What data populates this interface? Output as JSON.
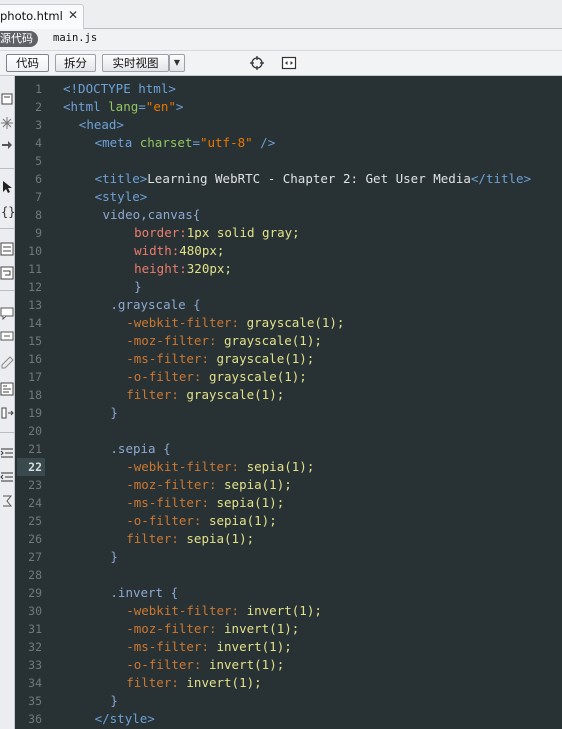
{
  "tab": {
    "filename": "photo.html",
    "close": "✕"
  },
  "filebar": {
    "source_label": "源代码",
    "related_file": "main.js"
  },
  "viewbar": {
    "code_label": "代码",
    "split_label": "拆分",
    "live_label": "实时视图",
    "dropdown_glyph": "▼"
  },
  "editor": {
    "current_line": 22,
    "lines": [
      {
        "n": "1",
        "indent": 0,
        "tokens": [
          {
            "t": "<!DOCTYPE html>",
            "c": "tag"
          }
        ]
      },
      {
        "n": "2",
        "indent": 0,
        "tokens": [
          {
            "t": "<html ",
            "c": "tag"
          },
          {
            "t": "lang",
            "c": "attr"
          },
          {
            "t": "=",
            "c": "tag"
          },
          {
            "t": "\"en\"",
            "c": "str"
          },
          {
            "t": ">",
            "c": "tag"
          }
        ]
      },
      {
        "n": "3",
        "indent": 2,
        "tokens": [
          {
            "t": "<head>",
            "c": "tag"
          }
        ]
      },
      {
        "n": "4",
        "indent": 4,
        "tokens": [
          {
            "t": "<meta ",
            "c": "tag"
          },
          {
            "t": "charset",
            "c": "attr"
          },
          {
            "t": "=",
            "c": "tag"
          },
          {
            "t": "\"utf-8\"",
            "c": "str"
          },
          {
            "t": " />",
            "c": "tag"
          }
        ]
      },
      {
        "n": "5",
        "indent": 0,
        "tokens": []
      },
      {
        "n": "6",
        "indent": 4,
        "tokens": [
          {
            "t": "<title>",
            "c": "tag"
          },
          {
            "t": "Learning WebRTC - Chapter 2: Get User Media",
            "c": "txt"
          },
          {
            "t": "</title>",
            "c": "tag"
          }
        ]
      },
      {
        "n": "7",
        "indent": 4,
        "tokens": [
          {
            "t": "<style>",
            "c": "tag"
          }
        ]
      },
      {
        "n": "8",
        "indent": 5,
        "tokens": [
          {
            "t": "video,canvas{",
            "c": "sel"
          }
        ]
      },
      {
        "n": "9",
        "indent": 9,
        "tokens": [
          {
            "t": "border:",
            "c": "prop2"
          },
          {
            "t": "1px solid gray;",
            "c": "val"
          }
        ]
      },
      {
        "n": "10",
        "indent": 9,
        "tokens": [
          {
            "t": "width:",
            "c": "prop2"
          },
          {
            "t": "480px;",
            "c": "val"
          }
        ]
      },
      {
        "n": "11",
        "indent": 9,
        "tokens": [
          {
            "t": "height:",
            "c": "prop2"
          },
          {
            "t": "320px;",
            "c": "val"
          }
        ]
      },
      {
        "n": "12",
        "indent": 9,
        "tokens": [
          {
            "t": "}",
            "c": "sel"
          }
        ]
      },
      {
        "n": "13",
        "indent": 6,
        "tokens": [
          {
            "t": ".grayscale {",
            "c": "sel"
          }
        ]
      },
      {
        "n": "14",
        "indent": 8,
        "tokens": [
          {
            "t": "-webkit-filter: ",
            "c": "prop"
          },
          {
            "t": "grayscale(1);",
            "c": "val"
          }
        ]
      },
      {
        "n": "15",
        "indent": 8,
        "tokens": [
          {
            "t": "-moz-filter: ",
            "c": "prop"
          },
          {
            "t": "grayscale(1);",
            "c": "val"
          }
        ]
      },
      {
        "n": "16",
        "indent": 8,
        "tokens": [
          {
            "t": "-ms-filter: ",
            "c": "prop"
          },
          {
            "t": "grayscale(1);",
            "c": "val"
          }
        ]
      },
      {
        "n": "17",
        "indent": 8,
        "tokens": [
          {
            "t": "-o-filter: ",
            "c": "prop"
          },
          {
            "t": "grayscale(1);",
            "c": "val"
          }
        ]
      },
      {
        "n": "18",
        "indent": 8,
        "tokens": [
          {
            "t": "filter: ",
            "c": "prop"
          },
          {
            "t": "grayscale(1);",
            "c": "val"
          }
        ]
      },
      {
        "n": "19",
        "indent": 6,
        "tokens": [
          {
            "t": "}",
            "c": "sel"
          }
        ]
      },
      {
        "n": "20",
        "indent": 0,
        "tokens": []
      },
      {
        "n": "21",
        "indent": 6,
        "tokens": [
          {
            "t": ".sepia {",
            "c": "sel"
          }
        ]
      },
      {
        "n": "22",
        "indent": 8,
        "tokens": [
          {
            "t": "-webkit-filter: ",
            "c": "prop"
          },
          {
            "t": "sepia(1);",
            "c": "val"
          }
        ]
      },
      {
        "n": "23",
        "indent": 8,
        "tokens": [
          {
            "t": "-moz-filter: ",
            "c": "prop"
          },
          {
            "t": "sepia(1);",
            "c": "val"
          }
        ]
      },
      {
        "n": "24",
        "indent": 8,
        "tokens": [
          {
            "t": "-ms-filter: ",
            "c": "prop"
          },
          {
            "t": "sepia(1);",
            "c": "val"
          }
        ]
      },
      {
        "n": "25",
        "indent": 8,
        "tokens": [
          {
            "t": "-o-filter: ",
            "c": "prop"
          },
          {
            "t": "sepia(1);",
            "c": "val"
          }
        ]
      },
      {
        "n": "26",
        "indent": 8,
        "tokens": [
          {
            "t": "filter: ",
            "c": "prop"
          },
          {
            "t": "sepia(1);",
            "c": "val"
          }
        ]
      },
      {
        "n": "27",
        "indent": 6,
        "tokens": [
          {
            "t": "}",
            "c": "sel"
          }
        ]
      },
      {
        "n": "28",
        "indent": 0,
        "tokens": []
      },
      {
        "n": "29",
        "indent": 6,
        "tokens": [
          {
            "t": ".invert {",
            "c": "sel"
          }
        ]
      },
      {
        "n": "30",
        "indent": 8,
        "tokens": [
          {
            "t": "-webkit-filter: ",
            "c": "prop"
          },
          {
            "t": "invert(1);",
            "c": "val"
          }
        ]
      },
      {
        "n": "31",
        "indent": 8,
        "tokens": [
          {
            "t": "-moz-filter: ",
            "c": "prop"
          },
          {
            "t": "invert(1);",
            "c": "val"
          }
        ]
      },
      {
        "n": "32",
        "indent": 8,
        "tokens": [
          {
            "t": "-ms-filter: ",
            "c": "prop"
          },
          {
            "t": "invert(1);",
            "c": "val"
          }
        ]
      },
      {
        "n": "33",
        "indent": 8,
        "tokens": [
          {
            "t": "-o-filter: ",
            "c": "prop"
          },
          {
            "t": "invert(1);",
            "c": "val"
          }
        ]
      },
      {
        "n": "34",
        "indent": 8,
        "tokens": [
          {
            "t": "filter: ",
            "c": "prop"
          },
          {
            "t": "invert(1);",
            "c": "val"
          }
        ]
      },
      {
        "n": "35",
        "indent": 6,
        "tokens": [
          {
            "t": "}",
            "c": "sel"
          }
        ]
      },
      {
        "n": "36",
        "indent": 4,
        "tokens": [
          {
            "t": "</style>",
            "c": "tag"
          }
        ]
      }
    ]
  },
  "colors": {
    "editor_bg": "#283134",
    "tag": "#6ea1d6",
    "attr": "#93c763",
    "string": "#ec7600",
    "property": "#cc7832",
    "value": "#e2e28a"
  }
}
